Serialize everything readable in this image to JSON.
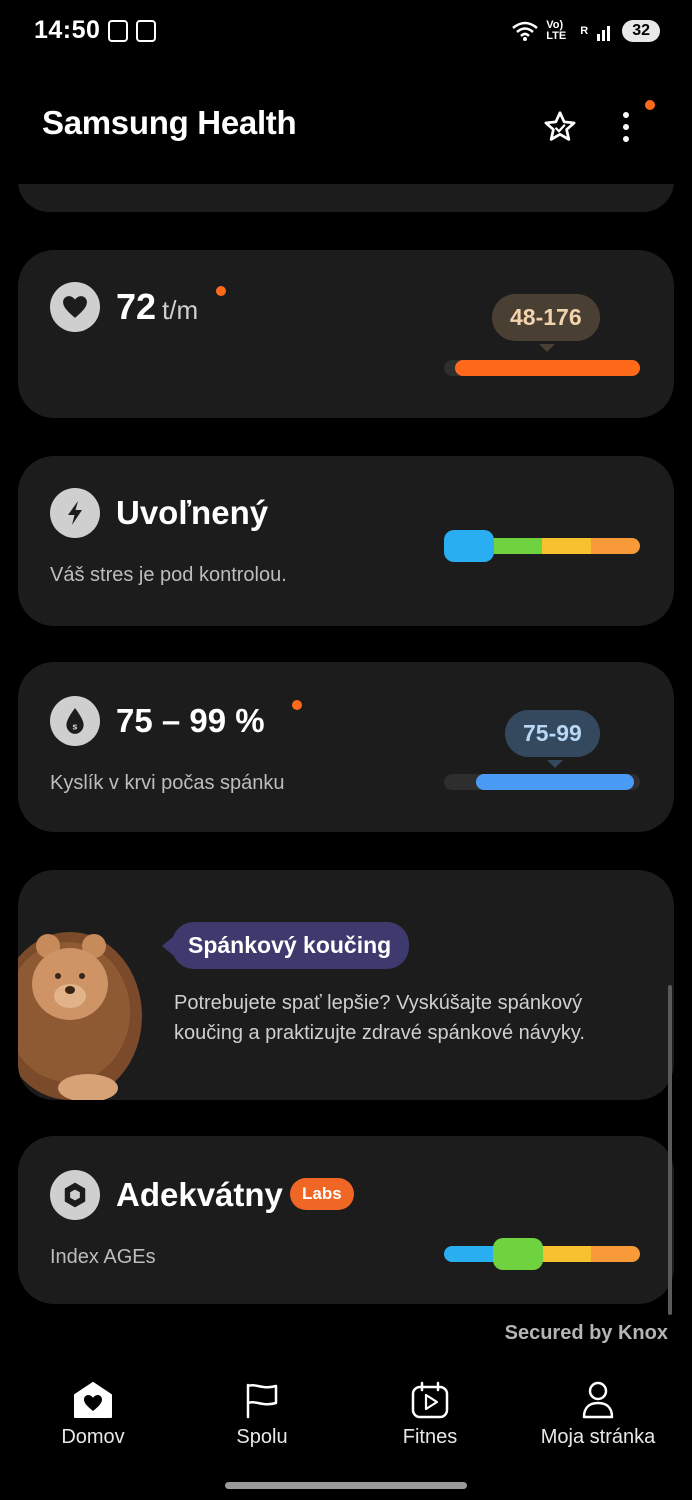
{
  "status_bar": {
    "time": "14:50",
    "network": "Vo) LTE",
    "sim": "R",
    "battery": "32"
  },
  "header": {
    "title": "Samsung Health",
    "favorite_icon": "star-icon",
    "menu_icon": "more-vertical-icon"
  },
  "heart_rate": {
    "icon": "heart-icon",
    "value": "72",
    "unit": "t/m",
    "range": "48-176",
    "accent": "#ff6a1a"
  },
  "stress": {
    "icon": "bolt-icon",
    "status": "Uvoľnený",
    "description": "Váš stres je pod kontrolou.",
    "level": "low"
  },
  "blood_oxygen": {
    "icon": "oxygen-drop-icon",
    "value": "75 – 99 %",
    "description": "Kyslík v krvi počas spánku",
    "range": "75-99",
    "accent": "#4a9bf5"
  },
  "sleep_coaching": {
    "badge": "Spánkový koučing",
    "text": "Potrebujete spať lepšie? Vyskúšajte spánkový koučing a praktizujte zdravé spánkové návyky.",
    "image": "lion-mascot"
  },
  "ages_index": {
    "icon": "hexagon-icon",
    "status": "Adekvátny",
    "labs_badge": "Labs",
    "description": "Index AGEs",
    "level": "low-medium"
  },
  "footer": {
    "secured_text": "Secured by Knox"
  },
  "bottom_nav": {
    "items": [
      {
        "label": "Domov",
        "icon": "home-heart-icon"
      },
      {
        "label": "Spolu",
        "icon": "flag-icon"
      },
      {
        "label": "Fitnes",
        "icon": "play-calendar-icon"
      },
      {
        "label": "Moja stránka",
        "icon": "person-icon"
      }
    ]
  }
}
